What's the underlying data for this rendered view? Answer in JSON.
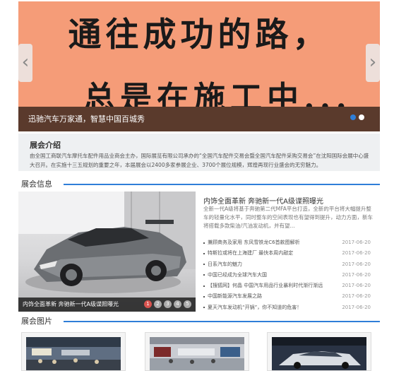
{
  "hero": {
    "line1": "通往成功的路，",
    "line2": "总是在施工中...",
    "caption": "迅驰汽车万家通，智慧中国百城秀",
    "dots": [
      true,
      false
    ]
  },
  "intro": {
    "title": "展会介绍",
    "text": "由全国工商联汽车摩托车配件用品业商会主办，国际展览有限公司承办的“全国汽车配件交易会暨全国汽车配件采购交易会”在沈阳国际会展中心盛大召开。在实施十三五规划的重要之年，本届展会以2400多家参展企业、3700个展位规模，辉煌再现行业盛会的无穷魅力。"
  },
  "sections": {
    "news_title": "展会信息",
    "gallery_title": "展会图片"
  },
  "feature": {
    "caption": "内饰全面革新 奔驰新一代A级谍照曝光",
    "pages": [
      "1",
      "2",
      "3",
      "4",
      "5"
    ],
    "active_page": 1,
    "headline": "内饰全面革新 奔驰新一代A级谍照曝光",
    "summary": "全新一代A级将基于奔驰第二代MFA平台打造，全新的平台将大幅提升整车的轻量化水平，同时整车的空间表现也有望得到提升，动力方面，新车将搭载多款柴油/汽油发动机，并有望..."
  },
  "news": [
    {
      "title": "兼顾商务及家用 东风雪铁龙C6首款图解析",
      "date": "2017-06-20"
    },
    {
      "title": "特斯拉或将在上海建厂 最快本周内敲定",
      "date": "2017-06-20"
    },
    {
      "title": "日系汽车的魅力",
      "date": "2017-06-20"
    },
    {
      "title": "中国已经成为全球汽车大国",
      "date": "2017-06-20"
    },
    {
      "title": "【搜狐网】何晶 中国汽车用品行业暴利时代渐行渐远",
      "date": "2017-06-20"
    },
    {
      "title": "中国新能源汽车发展之路",
      "date": "2017-06-20"
    },
    {
      "title": "夏天汽车发动机“开锅”，你不知道的危害！",
      "date": "2017-06-20"
    }
  ]
}
